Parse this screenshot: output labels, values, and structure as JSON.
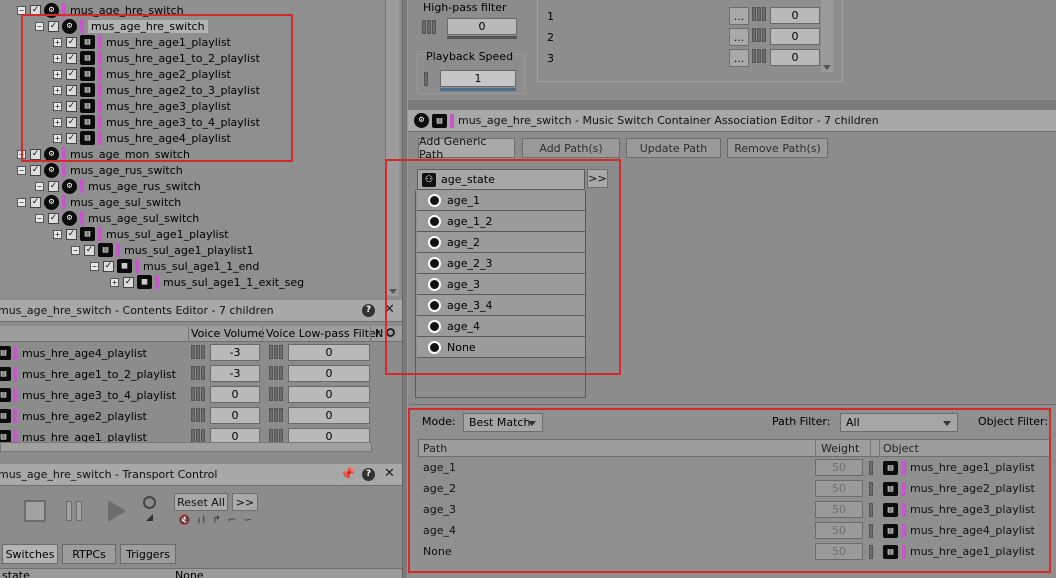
{
  "tree": {
    "items": [
      {
        "label": "mus_age_hre_switch",
        "depth": 0,
        "icon": "switch-container-icon"
      },
      {
        "label": "mus_age_hre_switch",
        "depth": 1,
        "icon": "switch-container-icon",
        "selected": true
      },
      {
        "label": "mus_hre_age1_playlist",
        "depth": 2,
        "icon": "playlist-icon"
      },
      {
        "label": "mus_hre_age1_to_2_playlist",
        "depth": 2,
        "icon": "playlist-icon"
      },
      {
        "label": "mus_hre_age2_playlist",
        "depth": 2,
        "icon": "playlist-icon"
      },
      {
        "label": "mus_hre_age2_to_3_playlist",
        "depth": 2,
        "icon": "playlist-icon"
      },
      {
        "label": "mus_hre_age3_playlist",
        "depth": 2,
        "icon": "playlist-icon"
      },
      {
        "label": "mus_hre_age3_to_4_playlist",
        "depth": 2,
        "icon": "playlist-icon"
      },
      {
        "label": "mus_hre_age4_playlist",
        "depth": 2,
        "icon": "playlist-icon"
      },
      {
        "label": "mus_age_mon_switch",
        "depth": 0,
        "icon": "switch-container-icon"
      },
      {
        "label": "mus_age_rus_switch",
        "depth": 0,
        "icon": "switch-container-icon"
      },
      {
        "label": "mus_age_rus_switch",
        "depth": 1,
        "icon": "switch-container-icon"
      },
      {
        "label": "mus_age_sul_switch",
        "depth": 0,
        "icon": "switch-container-icon"
      },
      {
        "label": "mus_age_sul_switch",
        "depth": 1,
        "icon": "switch-container-icon"
      },
      {
        "label": "mus_sul_age1_playlist",
        "depth": 2,
        "icon": "playlist-icon"
      },
      {
        "label": "mus_sul_age1_playlist1",
        "depth": 3,
        "icon": "playlist-icon"
      },
      {
        "label": "mus_sul_age1_1_end",
        "depth": 4,
        "icon": "segment-icon"
      },
      {
        "label": "mus_sul_age1_1_exit_seg",
        "depth": 5,
        "icon": "segment-icon"
      }
    ]
  },
  "property": {
    "highpass_label": "High-pass filter",
    "highpass_value": "0",
    "playback_label": "Playback Speed",
    "playback_value": "1",
    "numbers": [
      "1",
      "2",
      "3"
    ],
    "dots": "...",
    "values": [
      "0",
      "0",
      "0"
    ]
  },
  "contents_editor": {
    "title": "mus_age_hre_switch - Contents Editor - 7 children",
    "help": "?",
    "close": "✕",
    "col_volume": "Voice Volume",
    "col_lowpass": "Voice Low-pass Filter",
    "col_n": "N",
    "rows": [
      {
        "name": "mus_hre_age4_playlist",
        "volume": "-3",
        "lowpass": "0"
      },
      {
        "name": "mus_hre_age1_to_2_playlist",
        "volume": "-3",
        "lowpass": "0"
      },
      {
        "name": "mus_hre_age3_to_4_playlist",
        "volume": "0",
        "lowpass": "0"
      },
      {
        "name": "mus_hre_age2_playlist",
        "volume": "0",
        "lowpass": "0"
      },
      {
        "name": "mus_hre_age1_playlist",
        "volume": "0",
        "lowpass": "0"
      }
    ]
  },
  "transport": {
    "title": "mus_age_hre_switch - Transport Control",
    "reset_all": "Reset All",
    "more": ">>",
    "tabs": [
      "Switches",
      "RTPCs",
      "Triggers"
    ],
    "state_label": "state",
    "state_value": "None"
  },
  "assoc_editor": {
    "title": "mus_age_hre_switch - Music Switch Container Association Editor - 7 children",
    "buttons": {
      "add_generic": "Add Generic Path",
      "add_paths": "Add Path(s)",
      "update_path": "Update Path",
      "remove_paths": "Remove Path(s)"
    },
    "state_group": "age_state",
    "expand": ">>",
    "states": [
      "age_1",
      "age_1_2",
      "age_2",
      "age_2_3",
      "age_3",
      "age_3_4",
      "age_4",
      "None"
    ],
    "mode_label": "Mode:",
    "mode_value": "Best Match",
    "path_filter_label": "Path Filter:",
    "path_filter_value": "All",
    "object_filter_label": "Object Filter:",
    "col_path": "Path",
    "col_weight": "Weight",
    "col_object": "Object",
    "rows": [
      {
        "path": "age_1",
        "weight": "50",
        "object": "mus_hre_age1_playlist"
      },
      {
        "path": "age_2",
        "weight": "50",
        "object": "mus_hre_age2_playlist"
      },
      {
        "path": "age_3",
        "weight": "50",
        "object": "mus_hre_age3_playlist"
      },
      {
        "path": "age_4",
        "weight": "50",
        "object": "mus_hre_age4_playlist"
      },
      {
        "path": "None",
        "weight": "50",
        "object": "mus_hre_age1_playlist"
      }
    ]
  },
  "colors": {
    "highlight": "#d42a2a",
    "playlist_marker": "#c45ac9"
  }
}
